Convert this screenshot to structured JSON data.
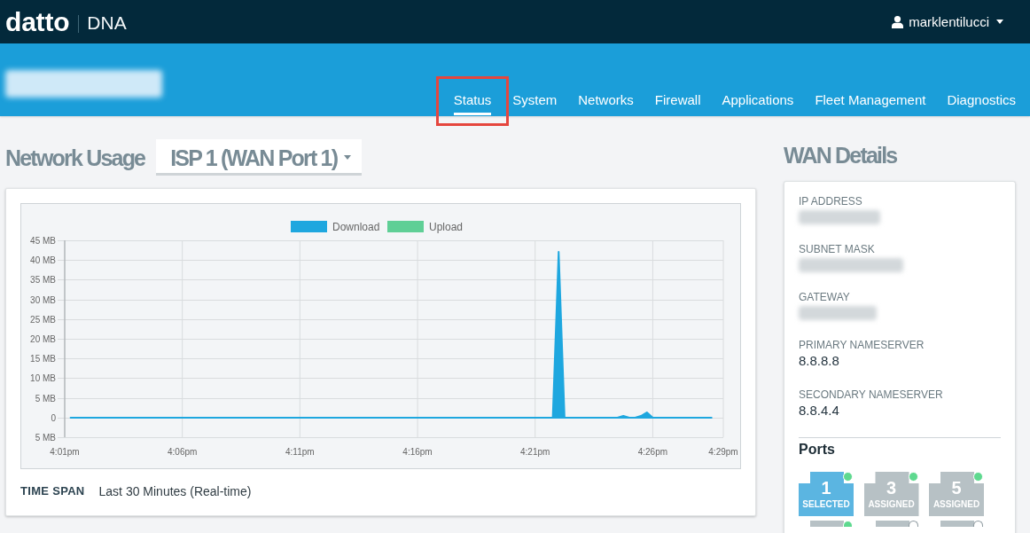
{
  "header": {
    "logo": {
      "brand": "datto",
      "product": "DNA"
    },
    "user": {
      "name": "marklentilucci"
    }
  },
  "device_bar": {
    "name_redacted": true,
    "tabs": [
      {
        "label": "Status",
        "selected": true,
        "highlighted": true
      },
      {
        "label": "System",
        "selected": false,
        "highlighted": false
      },
      {
        "label": "Networks",
        "selected": false,
        "highlighted": false
      },
      {
        "label": "Firewall",
        "selected": false,
        "highlighted": false
      },
      {
        "label": "Applications",
        "selected": false,
        "highlighted": false
      },
      {
        "label": "Fleet Management",
        "selected": false,
        "highlighted": false
      },
      {
        "label": "Diagnostics",
        "selected": false,
        "highlighted": false
      }
    ]
  },
  "network_usage": {
    "title": "Network Usage",
    "wan_select": {
      "value": "ISP 1 (WAN Port 1)"
    },
    "chart_data": {
      "type": "area",
      "grid": true,
      "categories": [
        "4:01pm",
        null,
        null,
        null,
        null,
        null,
        null,
        null,
        null,
        null,
        null,
        null,
        null,
        null,
        null,
        null,
        null,
        null,
        null,
        null,
        "4:06pm",
        null,
        null,
        null,
        null,
        null,
        null,
        null,
        null,
        null,
        null,
        null,
        null,
        null,
        null,
        null,
        null,
        null,
        null,
        null,
        "4:11pm",
        null,
        null,
        null,
        null,
        null,
        null,
        null,
        null,
        null,
        null,
        null,
        null,
        null,
        null,
        null,
        null,
        null,
        null,
        null,
        "4:16pm",
        null,
        null,
        null,
        null,
        null,
        null,
        null,
        null,
        null,
        null,
        null,
        null,
        null,
        null,
        null,
        null,
        null,
        null,
        null,
        "4:21pm",
        null,
        null,
        null,
        null,
        null,
        null,
        null,
        null,
        null,
        null,
        null,
        null,
        null,
        null,
        null,
        null,
        null,
        null,
        null,
        "4:26pm",
        null,
        null,
        null,
        null,
        null,
        null,
        null,
        null,
        null,
        null,
        null,
        "4:29pm"
      ],
      "series": [
        {
          "name": "Download",
          "color": "#1ea7df",
          "values": [
            null,
            0,
            0,
            0,
            0,
            0,
            0,
            0,
            0,
            0,
            0,
            0,
            0,
            0,
            0,
            0,
            0,
            0,
            0,
            0,
            0,
            0,
            0,
            0,
            0,
            0,
            0,
            0,
            0,
            0,
            0,
            0,
            0,
            0,
            0,
            0,
            0,
            0,
            0,
            0,
            0,
            0,
            0,
            0,
            0,
            0,
            0,
            0,
            0,
            0,
            0,
            0,
            0,
            0,
            0,
            0,
            0,
            0,
            0,
            0,
            0,
            0,
            0,
            0,
            0,
            0,
            0,
            0,
            0,
            0,
            0,
            0,
            0,
            0,
            0,
            0,
            0,
            0,
            0,
            0,
            0,
            0,
            0,
            0,
            42,
            0,
            0,
            0,
            0,
            0,
            0,
            0,
            0,
            0,
            0,
            0.3,
            0,
            0,
            0.5,
            1.2,
            0,
            0,
            0,
            0,
            0,
            0,
            0,
            0,
            0,
            0,
            0,
            null,
            null
          ]
        },
        {
          "name": "Upload",
          "color": "#5fcf96",
          "values": [
            null,
            null,
            null,
            null,
            null,
            null,
            null,
            null,
            null,
            null,
            null,
            null,
            null,
            null,
            null,
            null,
            null,
            null,
            null,
            null,
            null,
            null,
            null,
            null,
            null,
            null,
            null,
            null,
            null,
            null,
            null,
            null,
            null,
            null,
            null,
            null,
            null,
            null,
            null,
            null,
            null,
            null,
            null,
            null,
            null,
            null,
            null,
            null,
            null,
            null,
            null,
            null,
            null,
            null,
            null,
            null,
            null,
            null,
            null,
            null,
            null,
            null,
            null,
            null,
            null,
            null,
            null,
            null,
            null,
            null,
            null,
            null,
            null,
            null,
            null,
            null,
            null,
            null,
            null,
            null,
            null,
            null,
            null,
            null,
            null,
            null,
            null,
            null,
            null,
            null,
            null,
            null,
            null,
            null,
            null,
            null,
            null,
            null,
            null,
            null,
            null,
            null,
            null,
            null,
            null,
            null,
            null,
            null,
            null,
            null,
            null,
            null,
            null
          ]
        }
      ],
      "ylim": [
        -5,
        45
      ],
      "yticks": [
        {
          "value": -5,
          "label": "5 MB"
        },
        {
          "value": 0,
          "label": "0"
        },
        {
          "value": 5,
          "label": "5 MB"
        },
        {
          "value": 10,
          "label": "10 MB"
        },
        {
          "value": 15,
          "label": "15 MB"
        },
        {
          "value": 20,
          "label": "20 MB"
        },
        {
          "value": 25,
          "label": "25 MB"
        },
        {
          "value": 30,
          "label": "30 MB"
        },
        {
          "value": 35,
          "label": "35 MB"
        },
        {
          "value": 40,
          "label": "40 MB"
        },
        {
          "value": 45,
          "label": "45 MB"
        }
      ]
    },
    "time_span": {
      "label": "TIME SPAN",
      "value": "Last 30 Minutes (Real-time)"
    }
  },
  "wan_details": {
    "title": "WAN Details",
    "fields": [
      {
        "label": "IP ADDRESS",
        "redacted": true
      },
      {
        "label": "SUBNET MASK",
        "redacted": true
      },
      {
        "label": "GATEWAY",
        "redacted": true
      },
      {
        "label": "PRIMARY NAMESERVER",
        "value": "8.8.8.8",
        "redacted": false
      },
      {
        "label": "SECONDARY NAMESERVER",
        "value": "8.8.4.4",
        "redacted": false
      }
    ],
    "ports": {
      "title": "Ports",
      "items": [
        {
          "number": "1",
          "label": "SELECTED",
          "selected": true,
          "connected": true
        },
        {
          "number": "3",
          "label": "ASSIGNED",
          "selected": false,
          "connected": true
        },
        {
          "number": "5",
          "label": "ASSIGNED",
          "selected": false,
          "connected": true
        },
        {
          "selected": false,
          "connected": true
        },
        {
          "selected": false,
          "connected": false
        },
        {
          "selected": false,
          "connected": false
        }
      ]
    }
  }
}
